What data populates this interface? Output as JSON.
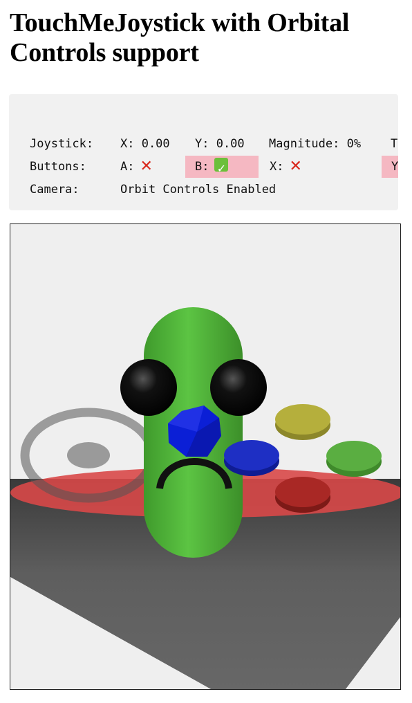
{
  "page": {
    "title": "TouchMeJoystick with Orbital Controls support"
  },
  "status": {
    "joystick": {
      "label": "Joystick:",
      "x": "X: 0.00",
      "y": "Y: 0.00",
      "magnitude": "Magnitude: 0%",
      "touch": "Tou"
    },
    "buttons": {
      "label": "Buttons:",
      "a": {
        "label": "A:",
        "pressed": false,
        "icon": "cross-mark-icon"
      },
      "b": {
        "label": "B:",
        "pressed": true,
        "icon": "check-mark-icon"
      },
      "x": {
        "label": "X:",
        "pressed": false,
        "icon": "cross-mark-icon"
      },
      "y": {
        "label": "Y:",
        "pressed": true
      }
    },
    "camera": {
      "label": "Camera:",
      "value": "Orbit Controls Enabled"
    }
  },
  "colors": {
    "panel_bg": "#f1f1f1",
    "pressed_bg": "#f5b8c2",
    "cross": "#d9271b",
    "check": "#6cbf3a",
    "character": "#4caf35",
    "button_yellow": "#b3ad3c",
    "button_green": "#58ad3f",
    "button_blue": "#1e2ec2",
    "button_red": "#a82723",
    "floor_ring": "#d64a4a"
  }
}
